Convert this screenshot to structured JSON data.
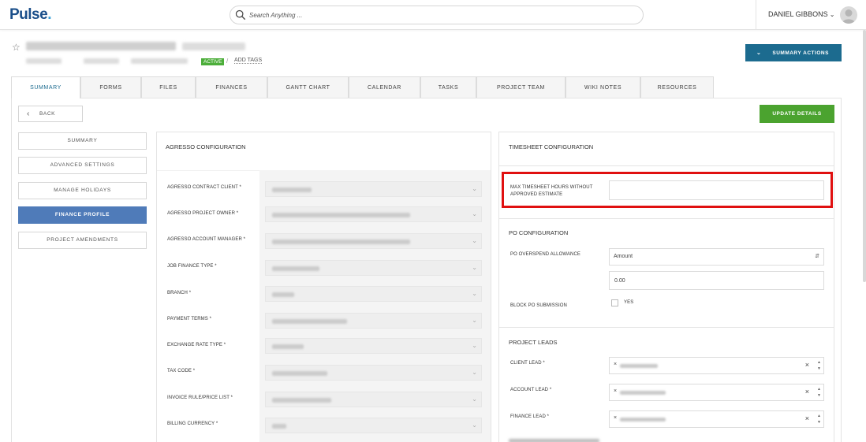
{
  "app": {
    "logo": "Pulse"
  },
  "search": {
    "placeholder": "Search Anything ..."
  },
  "user": {
    "name": "DANIEL GIBBONS"
  },
  "project": {
    "status": "ACTIVE",
    "add_tags": "ADD TAGS"
  },
  "actions": {
    "summary_actions": "SUMMARY ACTIONS",
    "back": "BACK",
    "update_details": "UPDATE DETAILS"
  },
  "tabs": [
    {
      "label": "SUMMARY"
    },
    {
      "label": "FORMS"
    },
    {
      "label": "FILES"
    },
    {
      "label": "FINANCES"
    },
    {
      "label": "GANTT CHART"
    },
    {
      "label": "CALENDAR"
    },
    {
      "label": "TASKS"
    },
    {
      "label": "PROJECT TEAM"
    },
    {
      "label": "WIKI NOTES"
    },
    {
      "label": "RESOURCES"
    }
  ],
  "sidebar": {
    "items": [
      {
        "label": "SUMMARY"
      },
      {
        "label": "ADVANCED SETTINGS"
      },
      {
        "label": "MANAGE HOLIDAYS"
      },
      {
        "label": "FINANCE PROFILE"
      },
      {
        "label": "PROJECT AMENDMENTS"
      }
    ],
    "active": "FINANCE PROFILE"
  },
  "agresso": {
    "title": "AGRESSO CONFIGURATION",
    "fields": [
      {
        "label": "AGRESSO CONTRACT CLIENT *"
      },
      {
        "label": "AGRESSO PROJECT OWNER *"
      },
      {
        "label": "AGRESSO ACCOUNT MANAGER *"
      },
      {
        "label": "JOB FINANCE TYPE *"
      },
      {
        "label": "BRANCH *"
      },
      {
        "label": "PAYMENT TERMS *"
      },
      {
        "label": "EXCHANGE RATE TYPE *"
      },
      {
        "label": "TAX CODE *"
      },
      {
        "label": "INVOICE RULE/PRICE LIST *"
      },
      {
        "label": "BILLING CURRENCY *"
      }
    ]
  },
  "timesheet": {
    "title": "TIMESHEET CONFIGURATION",
    "max_hours_label_1": "MAX TIMESHEET HOURS WITHOUT",
    "max_hours_label_2": "APPROVED ESTIMATE",
    "max_hours_value": ""
  },
  "po": {
    "title": "PO CONFIGURATION",
    "overspend_label": "PO OVERSPEND ALLOWANCE",
    "overspend_type": "Amount",
    "overspend_value": "0.00",
    "block_label": "BLOCK PO SUBMISSION",
    "block_option": "YES"
  },
  "leads": {
    "title": "PROJECT LEADS",
    "client_lead": "CLIENT LEAD *",
    "account_lead": "ACCOUNT LEAD *",
    "finance_lead": "FINANCE LEAD *"
  }
}
